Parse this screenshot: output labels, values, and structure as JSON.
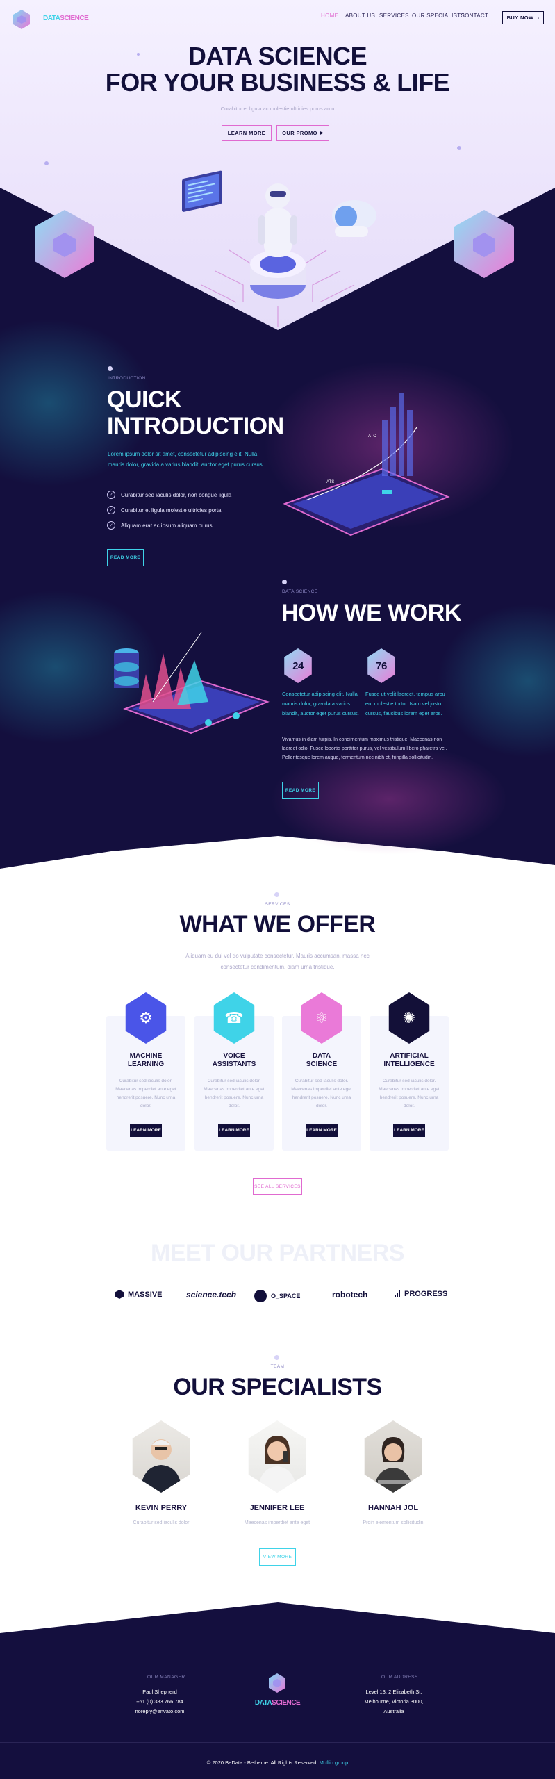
{
  "brand": {
    "part1": "DATA",
    "part2": "SCIENCE"
  },
  "nav": {
    "items": [
      "HOME",
      "ABOUT US",
      "SERVICES",
      "OUR SPECIALISTS",
      "CONTACT"
    ],
    "buy_now": "BUY NOW"
  },
  "hero": {
    "title_line1": "DATA SCIENCE",
    "title_line2": "FOR YOUR BUSINESS & LIFE",
    "subtitle": "Curabitur et ligula ac molestie ultricies purus arcu",
    "learn_more": "LEARN MORE",
    "our_promo": "OUR PROMO"
  },
  "intro": {
    "eyebrow": "INTRODUCTION",
    "title_line1": "QUICK",
    "title_line2": "INTRODUCTION",
    "lead": "Lorem ipsum dolor sit amet, consectetur adipiscing elit. Nulla mauris dolor, gravida a varius blandit, auctor eget purus cursus.",
    "checks": [
      "Curabitur sed iaculis dolor, non congue ligula",
      "Curabitur et ligula molestie ultricies porta",
      "Aliquam erat ac ipsum aliquam purus"
    ],
    "read_more": "READ MORE"
  },
  "how": {
    "eyebrow": "DATA SCIENCE",
    "title": "HOW WE WORK",
    "stat1": "24",
    "stat2": "76",
    "stat1_text": "Consectetur adipiscing elit. Nulla mauris dolor, gravida a varius blandit, auctor eget purus cursus.",
    "stat2_text": "Fusce ut velit laoreet, tempus arcu eu, molestie tortor. Nam vel justo cursus, faucibus lorem eget eros.",
    "body": "Vivamus in diam turpis. In condimentum maximus tristique. Maecenas non laoreet odio. Fusce lobortis porttitor purus, vel vestibulum libero pharetra vel. Pellentesque lorem augue, fermentum nec nibh et, fringilla sollicitudin.",
    "read_more": "READ MORE"
  },
  "offer": {
    "eyebrow": "SERVICES",
    "title": "WHAT WE OFFER",
    "subtitle_line1": "Aliquam eu dui vel do vulputate consectetur. Mauris accumsan, massa nec",
    "subtitle_line2": "consectetur condimentum, diam urna tristique.",
    "cards": [
      {
        "title_line1": "MACHINE",
        "title_line2": "LEARNING",
        "text": "Curabitur sed iaculis dolor. Maecenas imperdiet ante eget hendrerit posuere. Nunc urna dolor.",
        "button": "LEARN MORE",
        "color": "#4a55e8",
        "icon": "robot-icon"
      },
      {
        "title_line1": "VOICE",
        "title_line2": "ASSISTANTS",
        "text": "Curabitur sed iaculis dolor. Maecenas imperdiet ante eget hendrerit posuere. Nunc urna dolor.",
        "button": "LEARN MORE",
        "color": "#3fd3e8",
        "icon": "voice-icon"
      },
      {
        "title_line1": "DATA",
        "title_line2": "SCIENCE",
        "text": "Curabitur sed iaculis dolor. Maecenas imperdiet ante eget hendrerit posuere. Nunc urna dolor.",
        "button": "LEARN MORE",
        "color": "#ea7ad8",
        "icon": "data-icon"
      },
      {
        "title_line1": "ARTIFICIAL",
        "title_line2": "INTELLIGENCE",
        "text": "Curabitur sed iaculis dolor. Maecenas imperdiet ante eget hendrerit posuere. Nunc urna dolor.",
        "button": "LEARN MORE",
        "color": "#131038",
        "icon": "brain-icon"
      }
    ],
    "see_all": "SEE ALL SERVICES"
  },
  "partners": {
    "title": "MEET OUR PARTNERS",
    "items": [
      "MASSIVE",
      "science.tech",
      "O_SPACE",
      "robotech",
      "PROGRESS"
    ]
  },
  "specialists": {
    "eyebrow": "TEAM",
    "title": "OUR SPECIALISTS",
    "people": [
      {
        "name": "KEVIN PERRY",
        "role": "Curabitur sed iaculis dolor"
      },
      {
        "name": "JENNIFER LEE",
        "role": "Maecenas imperdiet ante eget"
      },
      {
        "name": "HANNAH JOL",
        "role": "Proin elementum sollicitudin"
      }
    ],
    "view_more": "VIEW MORE"
  },
  "footer": {
    "left_label": "OUR MANAGER",
    "left_lines": [
      "Paul Shepherd",
      "+61 (0) 383 766 784",
      "noreply@envato.com"
    ],
    "right_label": "OUR ADDRESS",
    "right_lines": [
      "Level 13, 2 Elizabeth St,",
      "Melbourne, Victoria 3000,",
      "Australia"
    ],
    "brand_part1": "DATA",
    "brand_part2": "SCIENCE",
    "copyright": "© 2020 BeData - Betheme. All Rights Reserved.",
    "copyright_link": "Muffin group"
  }
}
